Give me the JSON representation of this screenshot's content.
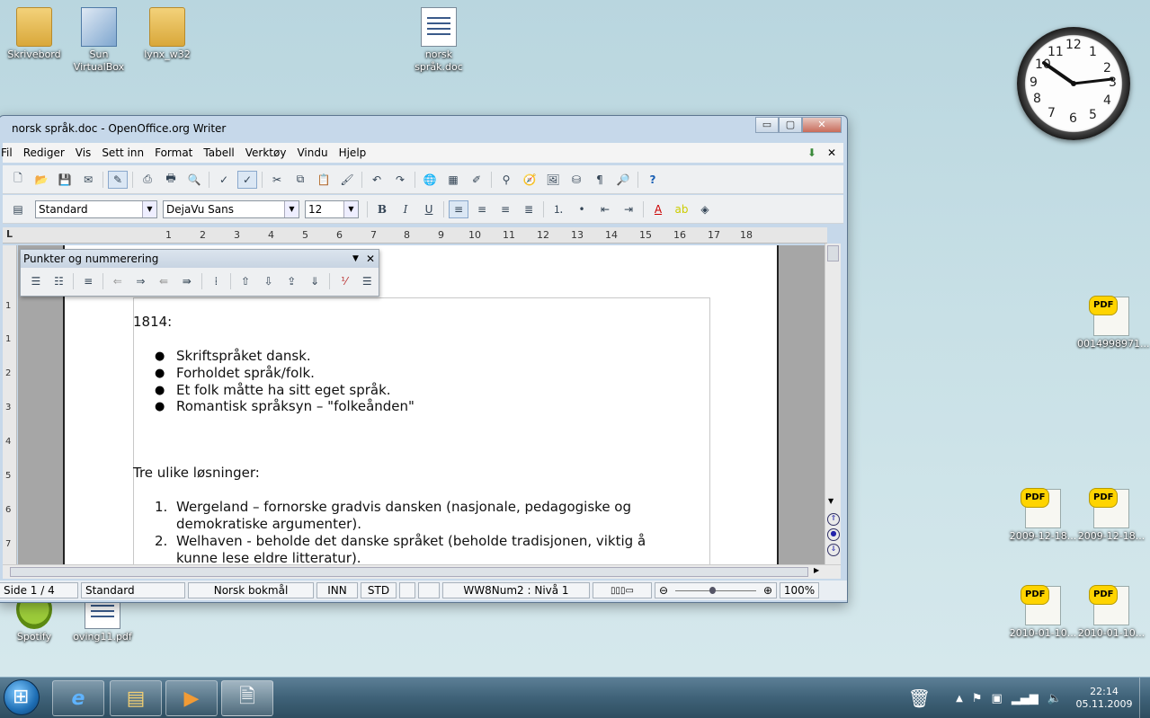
{
  "desktop": {
    "icons": [
      {
        "label": "Skrivebord"
      },
      {
        "label": "Sun VirtualBox"
      },
      {
        "label": "lynx_w32"
      },
      {
        "label": "norsk språk.doc"
      },
      {
        "label": "0014998971..."
      },
      {
        "label": "2009-12-18..."
      },
      {
        "label": "2009-12-18..."
      },
      {
        "label": "2010-01-10..."
      },
      {
        "label": "2010-01-10..."
      },
      {
        "label": "Spotify"
      },
      {
        "label": "oving11.pdf"
      }
    ],
    "pdf_tag": "PDF"
  },
  "window": {
    "title": "norsk språk.doc - OpenOffice.org Writer",
    "controls": {
      "minimize": "▭",
      "maximize": "▢",
      "close": "✕"
    },
    "menu": [
      "Fil",
      "Rediger",
      "Vis",
      "Sett inn",
      "Format",
      "Tabell",
      "Verktøy",
      "Vindu",
      "Hjelp"
    ],
    "format_bar": {
      "style": "Standard",
      "font": "DejaVu Sans",
      "size": "12",
      "bold": "B",
      "italic": "I",
      "underline": "U"
    },
    "ruler_marks": [
      "1",
      "2",
      "3",
      "4",
      "5",
      "6",
      "7",
      "8",
      "9",
      "10",
      "11",
      "12",
      "13",
      "14",
      "15",
      "16",
      "17",
      "18"
    ],
    "vruler_marks": [
      "1",
      "1",
      "2",
      "3",
      "4",
      "5",
      "6",
      "7"
    ],
    "floating_toolbar": {
      "title": "Punkter og nummerering"
    },
    "document": {
      "heading1": "1814:",
      "bullets": [
        "Skriftspråket dansk.",
        "Forholdet språk/folk.",
        "Et folk måtte ha sitt eget språk.",
        "Romantisk språksyn – \"folkeånden\""
      ],
      "heading2": "Tre ulike løsninger:",
      "numbered": [
        {
          "num": "1.",
          "line1": "Wergeland – fornorske gradvis dansken (nasjonale, pedagogiske og",
          "line2": "demokratiske argumenter)."
        },
        {
          "num": "2.",
          "line1": "Welhaven - beholde det danske språket (beholde tradisjonen, viktig å",
          "line2": "kunne lese eldre litteratur)."
        }
      ]
    },
    "status": {
      "page": "Side 1 / 4",
      "style": "Standard",
      "language": "Norsk bokmål",
      "insert": "INN",
      "selection": "STD",
      "list_level": "WW8Num2 : Nivå 1",
      "zoom": "100%"
    }
  },
  "clock_gadget": {
    "numbers": [
      "12",
      "1",
      "2",
      "3",
      "4",
      "5",
      "6",
      "7",
      "8",
      "9",
      "10",
      "11"
    ]
  },
  "taskbar": {
    "time": "22:14",
    "date": "05.11.2009"
  }
}
